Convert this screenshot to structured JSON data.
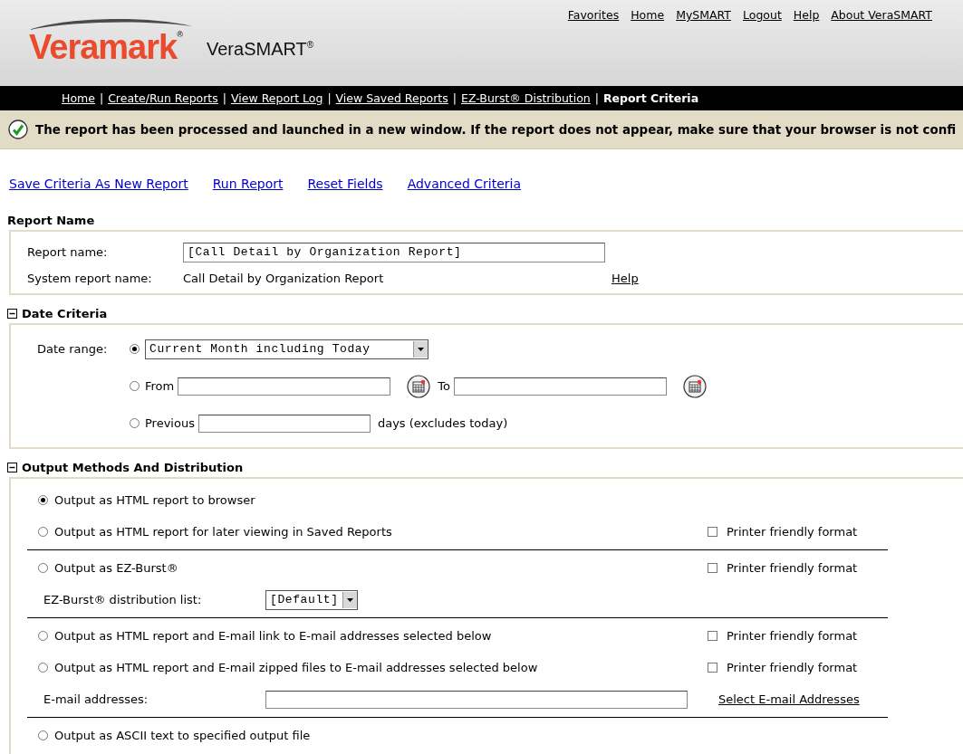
{
  "header": {
    "brand": "Veramark$^{®}$",
    "product": "VeraSMART$^{®}$",
    "top_links": [
      "Favorites",
      "Home",
      "MySMART",
      "Logout",
      "Help",
      "About VeraSMART"
    ]
  },
  "nav": {
    "items": [
      {
        "kind": "link",
        "label": "Home"
      },
      {
        "kind": "separator",
        "label": "|"
      },
      {
        "kind": "link",
        "label": "Create/Run Reports"
      },
      {
        "kind": "separator",
        "label": "|"
      },
      {
        "kind": "link",
        "label": "View Report Log"
      },
      {
        "kind": "separator",
        "label": "|"
      },
      {
        "kind": "link",
        "label": "View Saved Reports"
      },
      {
        "kind": "separator",
        "label": "|"
      },
      {
        "kind": "link",
        "label": "EZ-Burst® Distribution"
      },
      {
        "kind": "separator",
        "label": "|"
      },
      {
        "kind": "current",
        "label": "Report Criteria"
      }
    ]
  },
  "message": "The report has been processed and launched in a new window. If the report does not appear, make sure that your browser is not confi",
  "actions": [
    "Save Criteria As New Report",
    "Run Report",
    "Reset Fields",
    "Advanced Criteria"
  ],
  "report_name": {
    "title": "Report Name",
    "name_label": "Report name:",
    "name_value": "[Call Detail by Organization Report]",
    "system_label": "System report name:",
    "system_value": "Call Detail by Organization Report",
    "help": "Help"
  },
  "date_criteria": {
    "title": "Date Criteria",
    "expanded": true,
    "label": "Date range:",
    "range": {
      "selected": true,
      "value": "Current Month including Today"
    },
    "from_to": {
      "selected": false,
      "from_label": "From",
      "to_label": "To"
    },
    "previous": {
      "selected": false,
      "label": "Previous",
      "suffix": "days (excludes today)"
    }
  },
  "output": {
    "title": "Output Methods And Distribution",
    "expanded": true,
    "groups": [
      {
        "rows": [
          {
            "kind": "option",
            "label": "Output as HTML report to browser",
            "selected": true
          },
          {
            "kind": "option",
            "label": "Output as HTML report for later viewing in Saved Reports",
            "selected": false,
            "printer": {
              "label": "Printer friendly format",
              "checked": false
            }
          }
        ]
      },
      {
        "rows": [
          {
            "kind": "option",
            "label": "Output as EZ-Burst®",
            "selected": false,
            "printer": {
              "label": "Printer friendly format",
              "checked": false
            }
          },
          {
            "kind": "select",
            "label": "EZ-Burst® distribution list:",
            "value": "[Default]"
          }
        ]
      },
      {
        "rows": [
          {
            "kind": "option",
            "label": "Output as HTML report and E-mail link to E-mail addresses selected below",
            "selected": false,
            "printer": {
              "label": "Printer friendly format",
              "checked": false
            }
          },
          {
            "kind": "option",
            "label": "Output as HTML report and E-mail zipped files to E-mail addresses selected below",
            "selected": false,
            "printer": {
              "label": "Printer friendly format",
              "checked": false
            }
          },
          {
            "kind": "email",
            "label": "E-mail addresses:",
            "link": "Select E-mail Addresses"
          }
        ]
      },
      {
        "rows": [
          {
            "kind": "option",
            "label": "Output as ASCII text to specified output file",
            "selected": false
          }
        ]
      }
    ]
  }
}
